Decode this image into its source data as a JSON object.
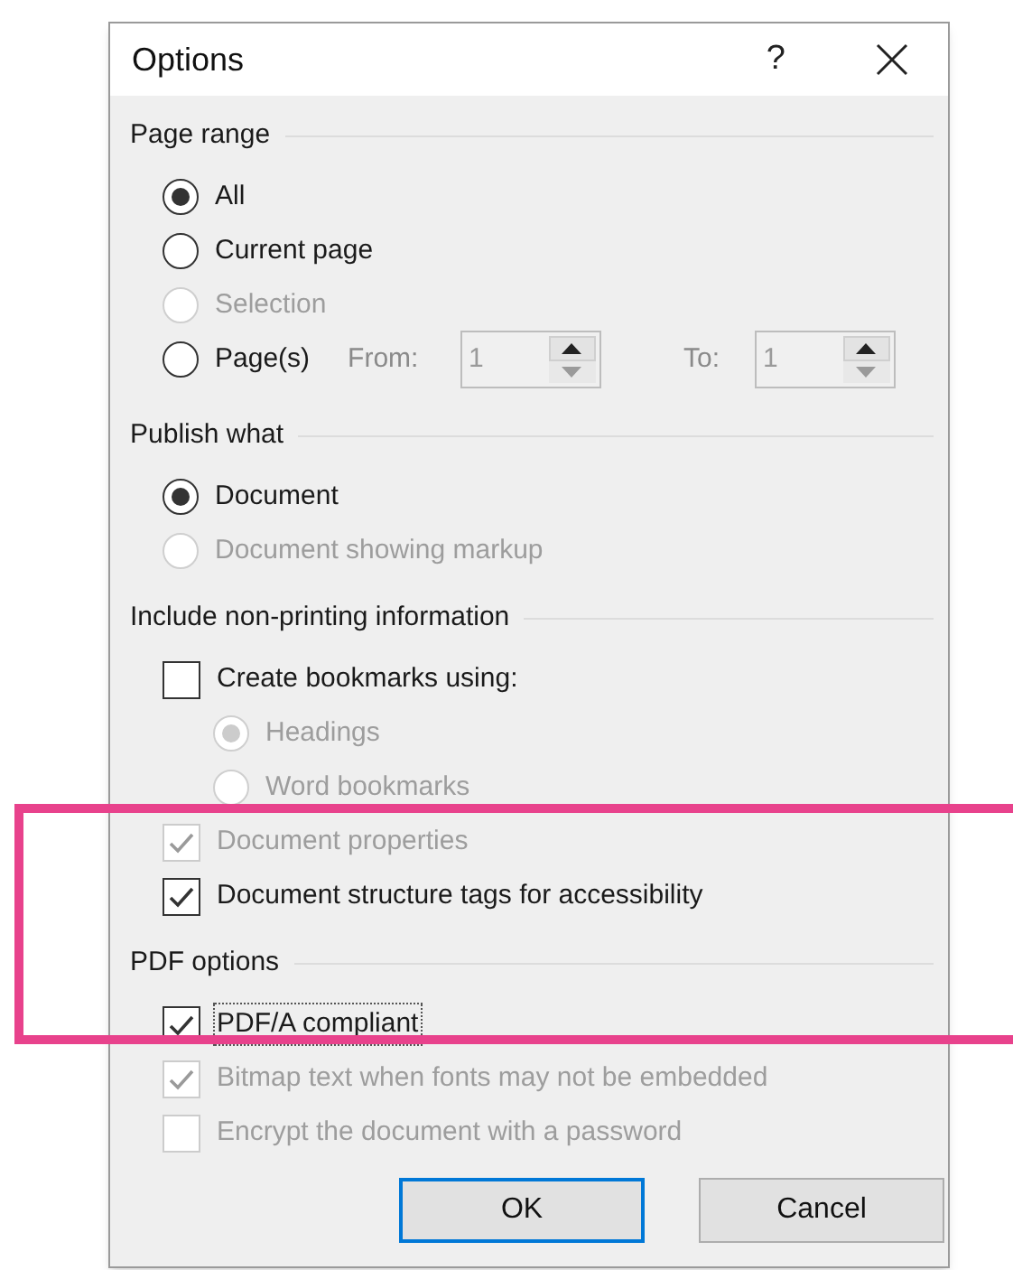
{
  "window": {
    "title": "Options",
    "help": "?"
  },
  "sections": [
    {
      "title": "Page range",
      "items": [
        {
          "kind": "radio",
          "label": "All",
          "selected": true,
          "disabled": false
        },
        {
          "kind": "radio",
          "label": "Current page",
          "selected": false,
          "disabled": false
        },
        {
          "kind": "radio",
          "label": "Selection",
          "selected": false,
          "disabled": true
        },
        {
          "kind": "radio",
          "label": "Page(s)",
          "selected": false,
          "disabled": false,
          "from": {
            "label": "From:",
            "value": "1"
          },
          "to": {
            "label": "To:",
            "value": "1"
          }
        }
      ]
    },
    {
      "title": "Publish what",
      "items": [
        {
          "kind": "radio",
          "label": "Document",
          "selected": true,
          "disabled": false
        },
        {
          "kind": "radio",
          "label": "Document showing markup",
          "selected": false,
          "disabled": true
        }
      ]
    },
    {
      "title": "Include non-printing information",
      "items": [
        {
          "kind": "checkbox",
          "label": "Create bookmarks using:",
          "checked": false,
          "disabled": false,
          "children": [
            {
              "kind": "radio",
              "label": "Headings",
              "selected": true,
              "disabled": true
            },
            {
              "kind": "radio",
              "label": "Word bookmarks",
              "selected": false,
              "disabled": true
            }
          ]
        },
        {
          "kind": "checkbox",
          "label": "Document properties",
          "checked": true,
          "disabled": true
        },
        {
          "kind": "checkbox",
          "label": "Document structure tags for accessibility",
          "checked": true,
          "disabled": false
        }
      ]
    },
    {
      "title": "PDF options",
      "items": [
        {
          "kind": "checkbox",
          "label": "PDF/A compliant",
          "checked": true,
          "disabled": false,
          "focused": true
        },
        {
          "kind": "checkbox",
          "label": "Bitmap text when fonts may not be embedded",
          "checked": true,
          "disabled": true
        },
        {
          "kind": "checkbox",
          "label": "Encrypt the document with a password",
          "checked": false,
          "disabled": true
        }
      ]
    }
  ],
  "buttons": [
    {
      "label": "OK",
      "default": true
    },
    {
      "label": "Cancel",
      "default": false
    }
  ]
}
